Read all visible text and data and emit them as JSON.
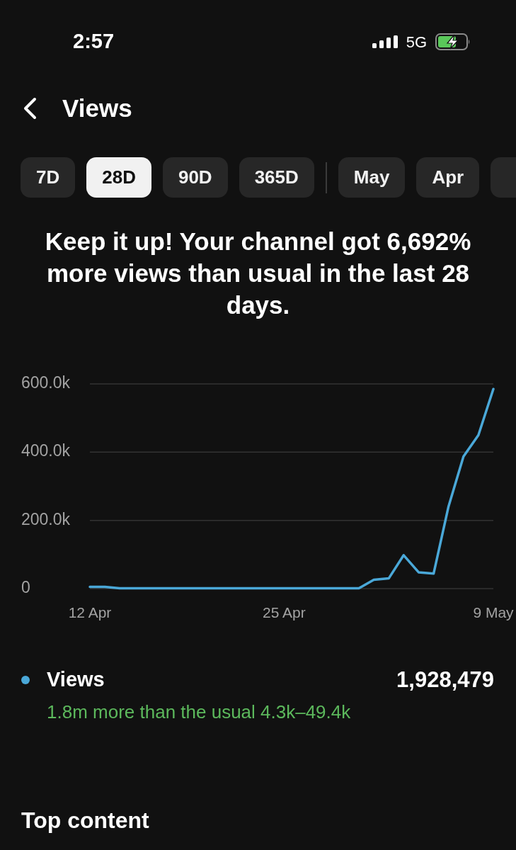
{
  "status_bar": {
    "time": "2:57",
    "network": "5G"
  },
  "header": {
    "title": "Views"
  },
  "period_tabs": [
    {
      "label": "7D",
      "selected": false
    },
    {
      "label": "28D",
      "selected": true
    },
    {
      "label": "90D",
      "selected": false
    },
    {
      "label": "365D",
      "selected": false
    }
  ],
  "month_tabs": [
    {
      "label": "May",
      "selected": false
    },
    {
      "label": "Apr",
      "selected": false
    }
  ],
  "message": "Keep it up! Your channel got 6,692% more views than usual in the last 28 days.",
  "chart": {
    "chart_data": {
      "type": "line",
      "categories": [
        "12 Apr",
        null,
        null,
        null,
        null,
        null,
        null,
        null,
        null,
        null,
        null,
        null,
        null,
        "25 Apr",
        null,
        null,
        null,
        null,
        null,
        null,
        null,
        null,
        null,
        null,
        null,
        null,
        null,
        "9 May"
      ],
      "ylim": [
        0,
        600000
      ],
      "yticks": [
        0,
        {
          "value": 200000,
          "label": "200.0k"
        },
        {
          "value": 400000,
          "label": "400.0k"
        },
        {
          "value": 600000,
          "label": "600.0k"
        }
      ],
      "series": [
        {
          "name": "Views",
          "color": "#4aa8d8",
          "values": [
            5000,
            5000,
            1000,
            1000,
            1000,
            1000,
            1000,
            1000,
            1000,
            1000,
            1000,
            1000,
            1000,
            1000,
            1000,
            1000,
            1000,
            1000,
            1000,
            26000,
            30000,
            98000,
            48000,
            44000,
            241000,
            387000,
            450000,
            585000
          ]
        }
      ]
    }
  },
  "legend": {
    "total": "1,928,479",
    "comparison": "1.8m more than the usual 4.3k–49.4k"
  },
  "section_title": "Top content"
}
